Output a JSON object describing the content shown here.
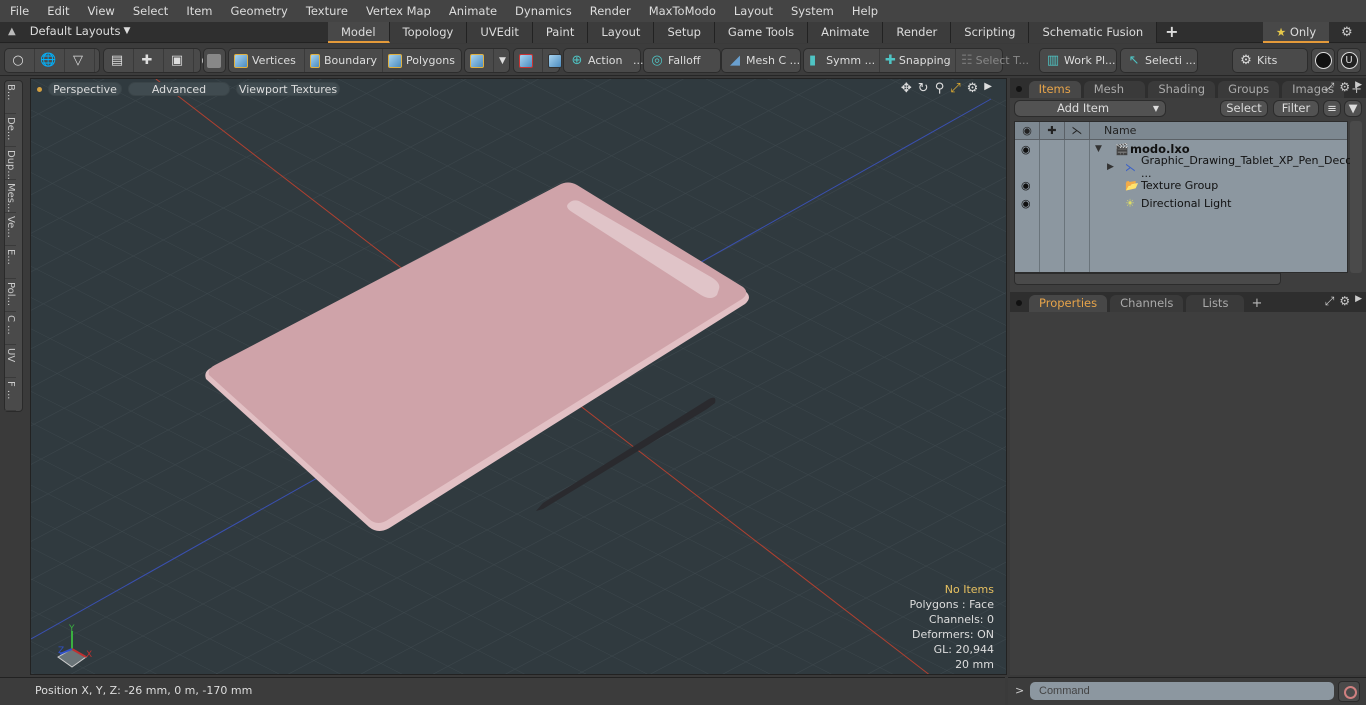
{
  "menu": [
    "File",
    "Edit",
    "View",
    "Select",
    "Item",
    "Geometry",
    "Texture",
    "Vertex Map",
    "Animate",
    "Dynamics",
    "Render",
    "MaxToModo",
    "Layout",
    "System",
    "Help"
  ],
  "layouts_label": "Default Layouts",
  "layout_tabs": [
    "Model",
    "Topology",
    "UVEdit",
    "Paint",
    "Layout",
    "Setup",
    "Game Tools",
    "Animate",
    "Render",
    "Scripting",
    "Schematic Fusion"
  ],
  "active_layout_tab": "Model",
  "only_label": "Only",
  "toolbar": {
    "vertices": "Vertices",
    "boundary": "Boundary",
    "polygons": "Polygons",
    "action": "Action",
    "falloff": "Falloff",
    "mesh_c": "Mesh C ...",
    "symm": "Symm ...",
    "snapping": "Snapping",
    "select_t": "Select T...",
    "work_pl": "Work Pl...",
    "selecti": "Selecti ...",
    "kits": "Kits",
    "ellipsis": "..."
  },
  "left_tools": [
    "B...",
    "De...",
    "Dup...",
    "Mes...",
    "Ve...",
    "E...",
    "Pol...",
    "C ...",
    "UV",
    "F ..."
  ],
  "viewport": {
    "perspective": "Perspective",
    "advanced": "Advanced",
    "textures": "Viewport Textures",
    "info": {
      "items": "No Items",
      "polygons": "Polygons : Face",
      "channels": "Channels: 0",
      "deformers": "Deformers: ON",
      "gl": "GL: 20,944",
      "scale": "20 mm"
    },
    "axis": {
      "x": "X",
      "y": "Y",
      "z": "Z"
    }
  },
  "items_panel": {
    "tabs": [
      "Items",
      "Mesh ...",
      "Shading",
      "Groups",
      "Images"
    ],
    "active_tab": "Items",
    "add_item": "Add Item",
    "select": "Select",
    "filter": "Filter",
    "col_name": "Name",
    "rows": [
      {
        "name": "modo.lxo",
        "visible": true,
        "bold": true
      },
      {
        "name": "Graphic_Drawing_Tablet_XP_Pen_Deco ...",
        "visible": false,
        "bold": false
      },
      {
        "name": "Texture Group",
        "visible": true,
        "bold": false
      },
      {
        "name": "Directional Light",
        "visible": true,
        "bold": false
      }
    ]
  },
  "props_panel": {
    "tabs": [
      "Properties",
      "Channels",
      "Lists"
    ],
    "active_tab": "Properties"
  },
  "status": {
    "position": "Position X, Y, Z:   -26 mm, 0 m, -170 mm"
  },
  "command": {
    "placeholder": "Command",
    "prompt": ">"
  }
}
